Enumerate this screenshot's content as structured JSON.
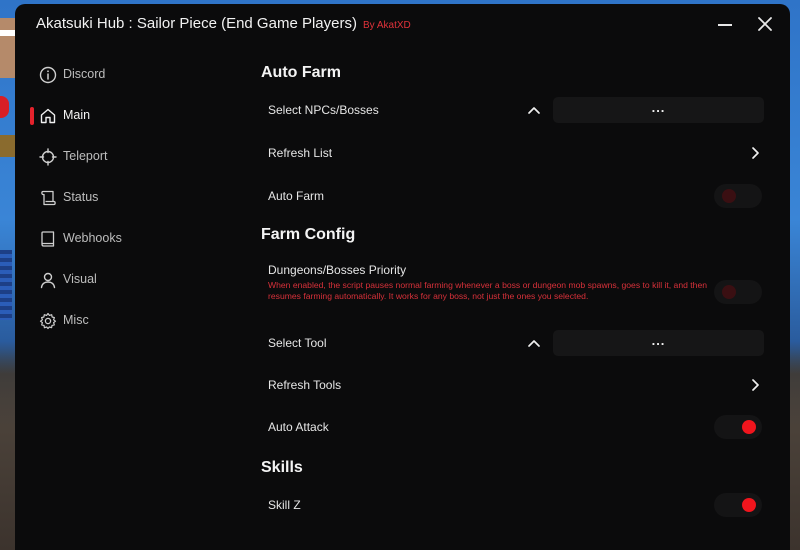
{
  "window": {
    "title": "Akatsuki Hub : Sailor Piece (End Game Players)",
    "byline": "By AkatXD"
  },
  "colors": {
    "accent": "#f0151d",
    "background": "#0b0b0c",
    "control": "#161617"
  },
  "sidebar": {
    "items": [
      {
        "label": "Discord",
        "icon": "info-icon",
        "active": false
      },
      {
        "label": "Main",
        "icon": "home-icon",
        "active": true
      },
      {
        "label": "Teleport",
        "icon": "crosshair-icon",
        "active": false
      },
      {
        "label": "Status",
        "icon": "scroll-icon",
        "active": false
      },
      {
        "label": "Webhooks",
        "icon": "book-icon",
        "active": false
      },
      {
        "label": "Visual",
        "icon": "user-icon",
        "active": false
      },
      {
        "label": "Misc",
        "icon": "gear-icon",
        "active": false
      }
    ]
  },
  "main": {
    "auto_farm": {
      "title": "Auto Farm",
      "select_npcs": {
        "label": "Select NPCs/Bosses",
        "value": "..."
      },
      "refresh_list": {
        "label": "Refresh List"
      },
      "auto_farm_toggle": {
        "label": "Auto Farm",
        "enabled": false
      }
    },
    "farm_config": {
      "title": "Farm Config",
      "priority": {
        "label": "Dungeons/Bosses Priority",
        "description": "When enabled, the script pauses normal farming whenever a boss or dungeon mob spawns, goes to kill it, and then resumes farming automatically. It works for any boss, not just the ones you selected.",
        "enabled": false
      },
      "select_tool": {
        "label": "Select Tool",
        "value": "..."
      },
      "refresh_tools": {
        "label": "Refresh Tools"
      },
      "auto_attack": {
        "label": "Auto Attack",
        "enabled": true
      }
    },
    "skills": {
      "title": "Skills",
      "skill_z": {
        "label": "Skill Z",
        "enabled": true
      }
    }
  }
}
